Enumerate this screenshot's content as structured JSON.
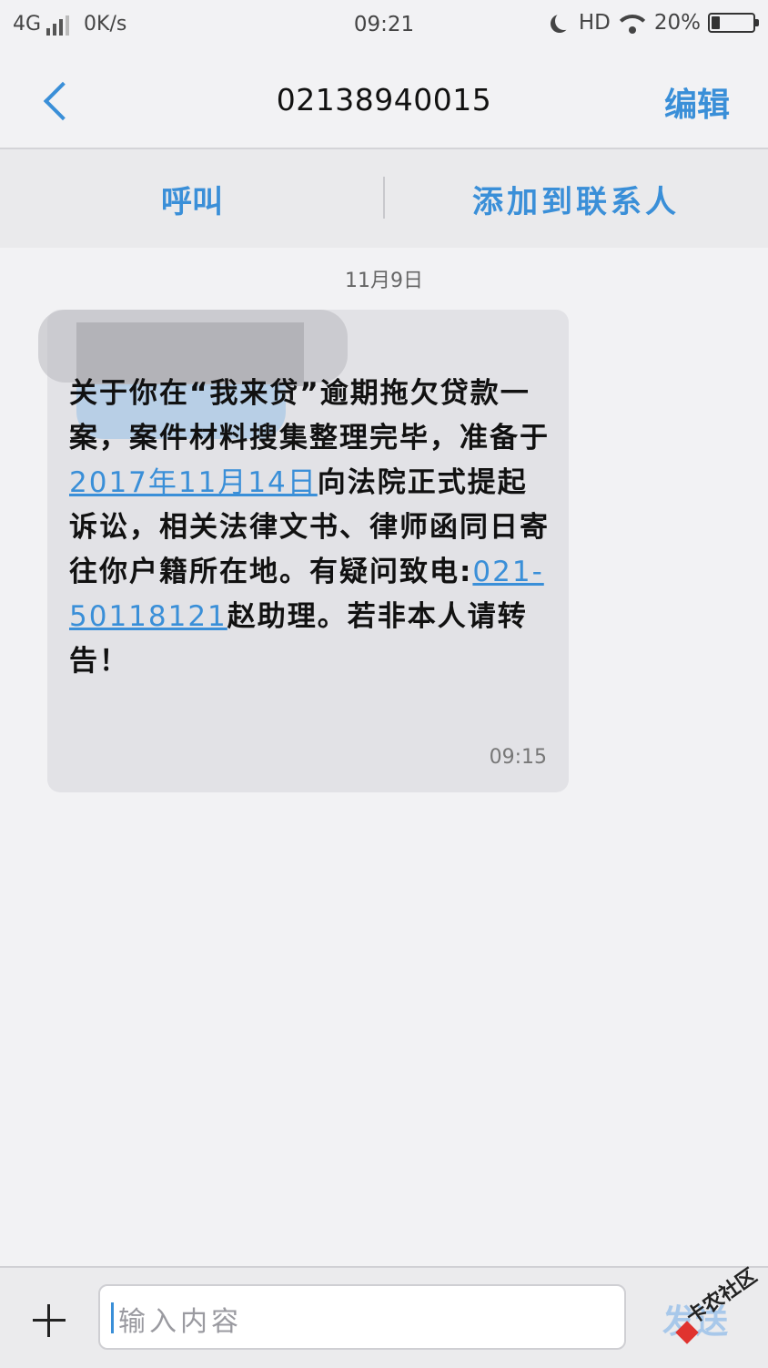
{
  "status_bar": {
    "network": "4G",
    "speed": "0K/s",
    "time": "09:21",
    "hd": "HD",
    "battery_text": "20%",
    "battery_level": 0.2
  },
  "header": {
    "title": "02138940015",
    "edit_label": "编辑"
  },
  "actions": {
    "call_label": "呼叫",
    "add_contact_label": "添加到联系人"
  },
  "conversation": {
    "date": "11月9日",
    "message": {
      "part1": "关于你在“我来贷”逾期拖欠贷款一案，案件材料搜集整理完毕，准备于",
      "date_link": "2017年11月14日",
      "part2": "向法院正式提起诉讼，相关法律文书、律师函同日寄往你户籍所在地。有疑问致电:",
      "phone_link": "021-50118121",
      "part3": "赵助理。若非本人请转告！",
      "time": "09:15"
    }
  },
  "compose": {
    "placeholder": "输入内容",
    "send_label": "发送"
  },
  "watermark": "卡农社区",
  "colors": {
    "accent": "#3a8fd8",
    "background": "#f2f2f4",
    "bubble": "#e2e2e6"
  }
}
